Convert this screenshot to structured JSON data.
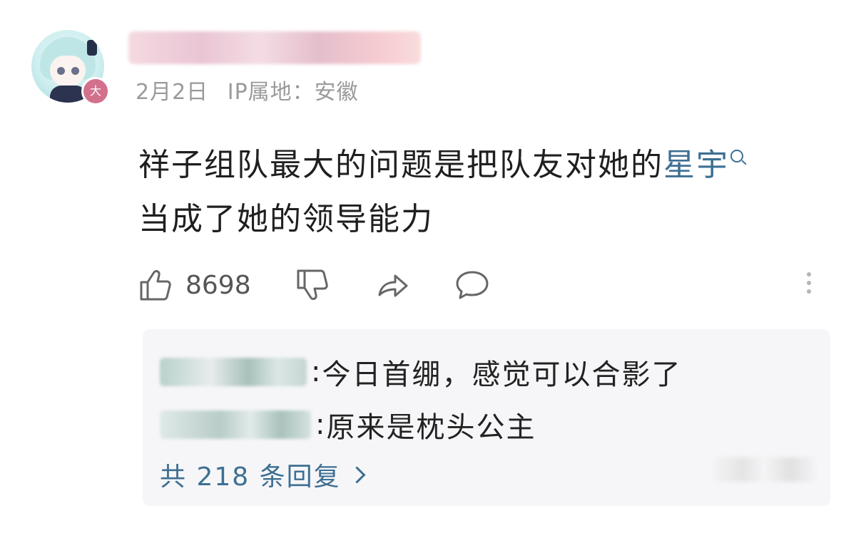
{
  "comment": {
    "date": "2月2日",
    "ip_location": "IP属地：安徽",
    "avatar_badge": "大",
    "text_before_link": "祥子组队最大的问题是把队友对她的",
    "link_text": "星宇",
    "text_after_link": "当成了她的领导能力",
    "like_count": "8698"
  },
  "replies": {
    "items": [
      {
        "separator": ":",
        "text": "今日首绷，感觉可以合影了"
      },
      {
        "separator": ":",
        "text": "原来是枕头公主"
      }
    ],
    "total_label": "共 218 条回复"
  },
  "icons": [
    "thumbs-up-icon",
    "thumbs-down-icon",
    "share-icon",
    "comment-icon",
    "more-vertical-icon",
    "search-icon",
    "chevron-right-icon"
  ],
  "colors": {
    "link": "#3e6f93",
    "meta": "#9a9a9a",
    "badge": "#d3708c",
    "reply_bg": "#f6f6f8"
  }
}
